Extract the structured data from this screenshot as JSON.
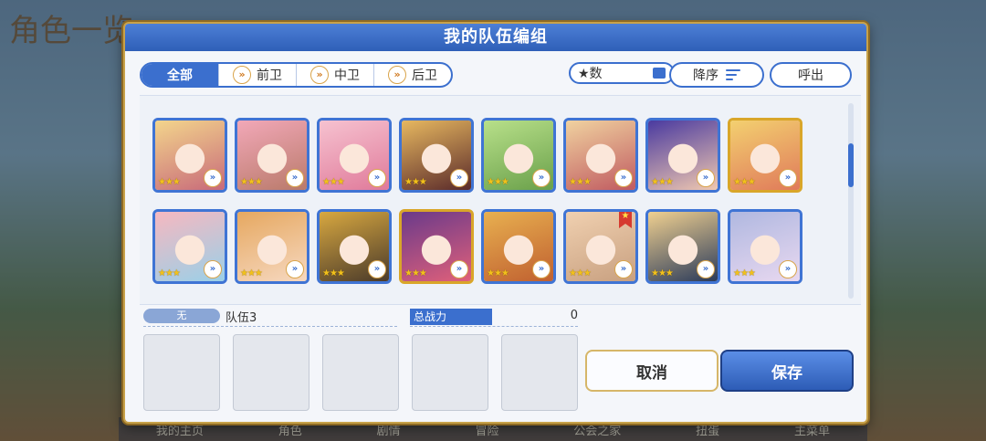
{
  "background": {
    "title": "角色一览",
    "nav_items": [
      "我的主页",
      "角色",
      "剧情",
      "冒险",
      "公会之家",
      "扭蛋",
      "主菜单"
    ]
  },
  "dialog": {
    "title": "我的队伍编组",
    "filter_tabs": [
      {
        "label": "全部",
        "active": true
      },
      {
        "label": "前卫",
        "active": false
      },
      {
        "label": "中卫",
        "active": false
      },
      {
        "label": "后卫",
        "active": false
      }
    ],
    "sort_key_label": "★数",
    "sort_order_label": "降序",
    "call_button_label": "呼出",
    "star_glyphs": "★★★☆☆",
    "position_glyph": "»",
    "favorite_glyph": "★",
    "characters_row1": [
      {
        "colors": [
          "#f3d58c",
          "#c86a7a"
        ],
        "gold": false,
        "stars": 3
      },
      {
        "colors": [
          "#f2a8b8",
          "#b97a6a"
        ],
        "gold": false,
        "stars": 3
      },
      {
        "colors": [
          "#f6c2d0",
          "#e07a9a"
        ],
        "gold": false,
        "stars": 3
      },
      {
        "colors": [
          "#e7b860",
          "#5a2a2a"
        ],
        "gold": false,
        "stars": 3
      },
      {
        "colors": [
          "#b8e08a",
          "#6aa04a"
        ],
        "gold": false,
        "stars": 3
      },
      {
        "colors": [
          "#f0d2a0",
          "#c05a60"
        ],
        "gold": false,
        "stars": 3
      },
      {
        "colors": [
          "#4a3aa0",
          "#f0c8b0"
        ],
        "gold": false,
        "stars": 3
      },
      {
        "colors": [
          "#f3d070",
          "#e07a5a"
        ],
        "gold": true,
        "stars": 3
      }
    ],
    "characters_row2": [
      {
        "colors": [
          "#f6b8c0",
          "#9ad0e8"
        ],
        "gold": false,
        "stars": 3
      },
      {
        "colors": [
          "#e6a860",
          "#f6d8c0"
        ],
        "gold": false,
        "stars": 3
      },
      {
        "colors": [
          "#d8a840",
          "#4a3a2a"
        ],
        "gold": false,
        "stars": 3
      },
      {
        "colors": [
          "#6a3a8a",
          "#e0607a"
        ],
        "gold": true,
        "stars": 3
      },
      {
        "colors": [
          "#e8b050",
          "#c06030"
        ],
        "gold": false,
        "stars": 3
      },
      {
        "colors": [
          "#f0d0b0",
          "#c8a080"
        ],
        "gold": false,
        "stars": 2,
        "favorite": true
      },
      {
        "colors": [
          "#f0d090",
          "#2a3a5a"
        ],
        "gold": false,
        "stars": 3
      },
      {
        "colors": [
          "#b0b8e0",
          "#e8d8f0"
        ],
        "gold": false,
        "stars": 2
      }
    ],
    "team": {
      "tag_label": "无",
      "name": "队伍3",
      "power_label": "总战力",
      "power_value": "0",
      "empty_slot_count": 5
    },
    "cancel_label": "取消",
    "save_label": "保存"
  }
}
